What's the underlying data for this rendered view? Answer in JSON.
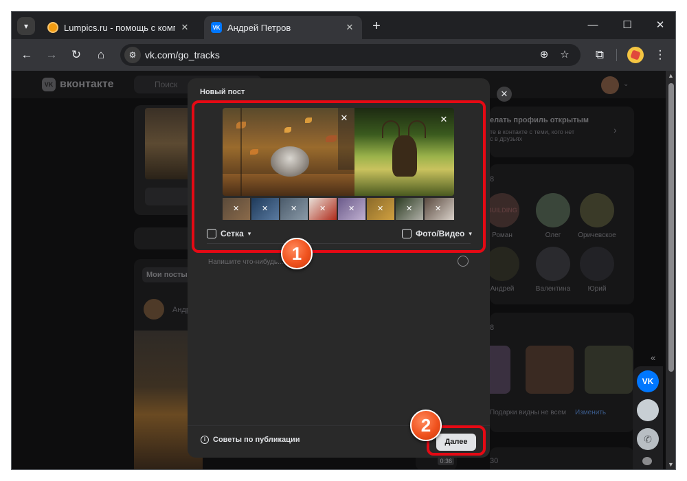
{
  "browser": {
    "tab_search_icon": "chevron-down-icon",
    "tabs": [
      {
        "title": "Lumpics.ru - помощь с компьютером",
        "active": false
      },
      {
        "title": "Андрей Петров",
        "active": true
      }
    ],
    "url": "vk.com/go_tracks"
  },
  "vk": {
    "logo_text": "вконтакте",
    "search_placeholder": "Поиск",
    "profile_open": {
      "title": "елать профиль открытым",
      "subtitle": "те в контакте с теми, кого нет\nс в друзьях"
    },
    "my_posts": "Мои посты",
    "post_author": "Андр",
    "friends": [
      "Роман",
      "Олег",
      "Оричевское",
      "Андрей",
      "Валентина",
      "Юрий"
    ],
    "building_label": "BUILDING",
    "gifts_note": "Подарки видны не всем",
    "gifts_change": "Изменить",
    "section_count_1": "8",
    "section_count_2": "8",
    "section_count_3": "30",
    "video_duration": "0:36"
  },
  "modal": {
    "title": "Новый пост",
    "grid_label": "Сетка",
    "media_label": "Фото/Видео",
    "compose_placeholder": "Напишите что-нибудь...",
    "tips_label": "Советы по публикации",
    "next_label": "Далее"
  },
  "annotations": {
    "badge_1": "1",
    "badge_2": "2",
    "highlight_color": "#e50914"
  },
  "colors": {
    "vk_blue": "#0077ff",
    "modal_bg": "#292929",
    "badge_orange": "#f0521e"
  }
}
